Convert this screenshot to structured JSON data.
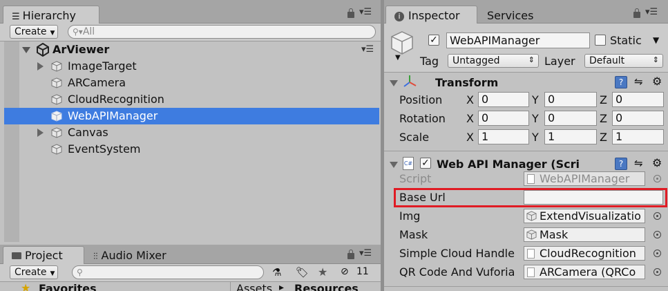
{
  "hierarchy": {
    "tab_label": "Hierarchy",
    "create_label": "Create",
    "search_placeholder": "All",
    "scene_name": "ArViewer",
    "items": [
      {
        "label": "ImageTarget",
        "expandable": true
      },
      {
        "label": "ARCamera",
        "expandable": false
      },
      {
        "label": "CloudRecognition",
        "expandable": false
      },
      {
        "label": "WebAPIManager",
        "expandable": false,
        "selected": true
      },
      {
        "label": "Canvas",
        "expandable": true
      },
      {
        "label": "EventSystem",
        "expandable": false
      }
    ]
  },
  "project": {
    "tab_label": "Project",
    "audio_tab_label": "Audio Mixer",
    "create_label": "Create",
    "hidden_count": "11",
    "favorites_label": "Favorites",
    "breadcrumb_root": "Assets",
    "breadcrumb_sep": "▸",
    "breadcrumb_current": "Resources"
  },
  "inspector": {
    "tab_label": "Inspector",
    "services_tab_label": "Services",
    "object_name": "WebAPIManager",
    "static_label": "Static",
    "tag_label": "Tag",
    "tag_value": "Untagged",
    "layer_label": "Layer",
    "layer_value": "Default",
    "transform": {
      "title": "Transform",
      "rows": [
        {
          "label": "Position",
          "x": "0",
          "y": "0",
          "z": "0"
        },
        {
          "label": "Rotation",
          "x": "0",
          "y": "0",
          "z": "0"
        },
        {
          "label": "Scale",
          "x": "1",
          "y": "1",
          "z": "1"
        }
      ],
      "axis_x": "X",
      "axis_y": "Y",
      "axis_z": "Z"
    },
    "script_component": {
      "title": "Web API Manager (Scri",
      "cs_badge": "C#",
      "fields": [
        {
          "label": "Script",
          "value": "WebAPIManager"
        },
        {
          "label": "Base Url",
          "value": ""
        },
        {
          "label": "Img",
          "value": "ExtendVisualizatio"
        },
        {
          "label": "Mask",
          "value": "Mask"
        },
        {
          "label": "Simple Cloud Handle",
          "value": "CloudRecognition"
        },
        {
          "label": "QR Code And Vuforia",
          "value": "ARCamera (QRCo"
        }
      ]
    }
  },
  "colors": {
    "selection": "#3e7ce0",
    "highlight_box": "#e01b24"
  }
}
